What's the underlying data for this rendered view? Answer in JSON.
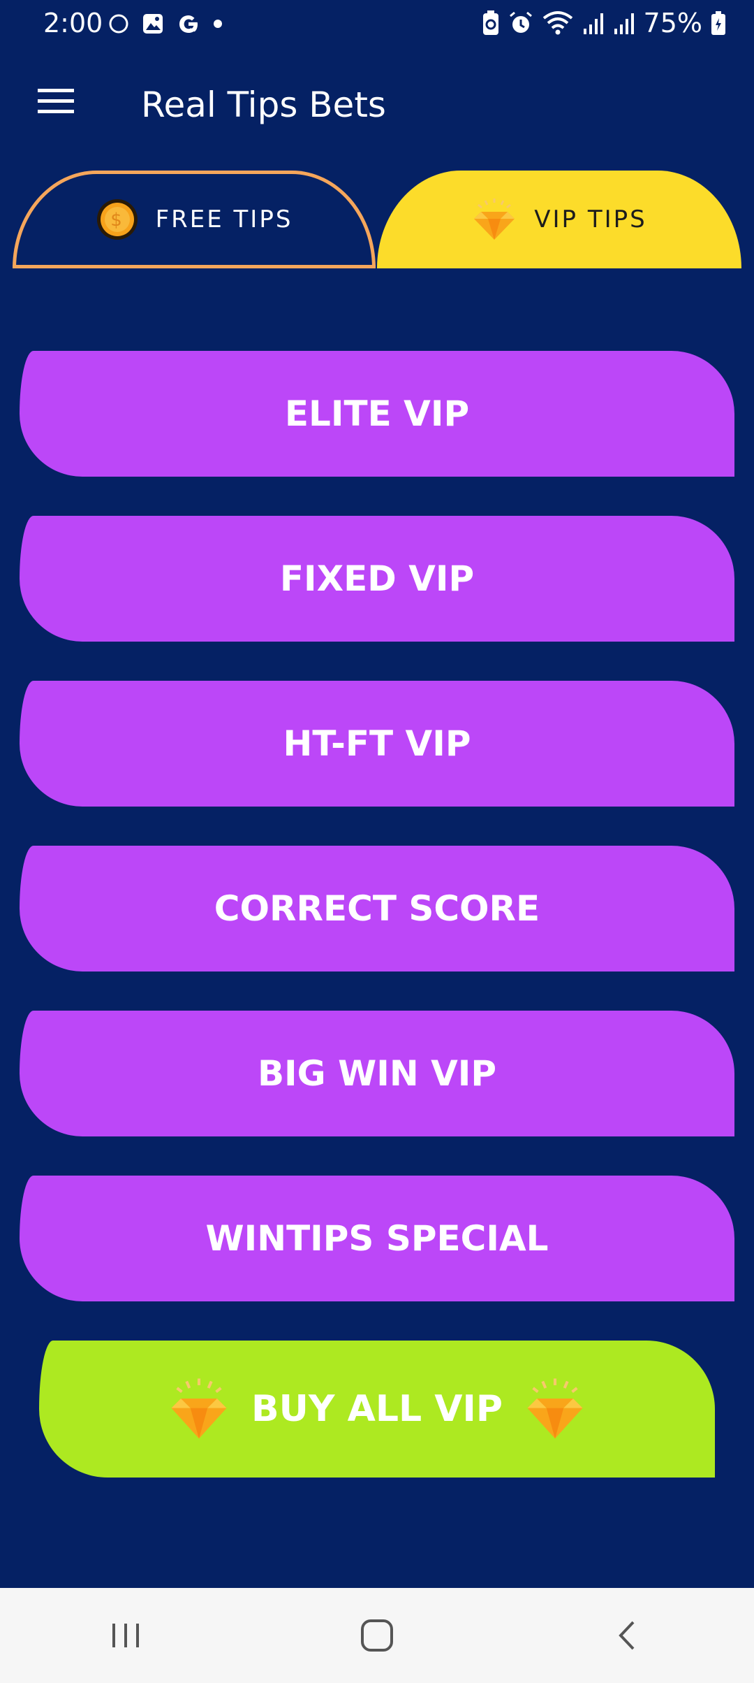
{
  "status_bar": {
    "time": "2:00",
    "battery": "75%",
    "left_icons": [
      "circle-icon",
      "image-icon",
      "google-icon",
      "dot-icon"
    ],
    "right_icons": [
      "battery-saver-icon",
      "alarm-icon",
      "wifi-icon",
      "signal-icon",
      "signal-icon",
      "battery-icon"
    ]
  },
  "app_bar": {
    "title": "Real Tips Bets",
    "menu_icon": "hamburger-menu-icon"
  },
  "tabs": [
    {
      "label": "FREE TIPS",
      "icon": "coin-icon",
      "active": false
    },
    {
      "label": "VIP TIPS",
      "icon": "diamond-icon",
      "active": true
    }
  ],
  "menu_items": [
    {
      "label": "ELITE VIP"
    },
    {
      "label": "FIXED VIP"
    },
    {
      "label": "HT-FT VIP"
    },
    {
      "label": "CORRECT SCORE"
    },
    {
      "label": "BIG WIN VIP"
    },
    {
      "label": "WINTIPS SPECIAL"
    }
  ],
  "buy_all": {
    "label": "BUY ALL VIP",
    "icon": "diamond-icon"
  },
  "colors": {
    "background": "#052164",
    "menu_item": "#bc47f8",
    "buy_all": "#ade921",
    "vip_tab": "#fcdc2a",
    "free_tab_border": "#f5a65b",
    "nav_bar": "#f6f6f6"
  },
  "nav_bar": {
    "icons": [
      "recent-apps-icon",
      "home-icon",
      "back-icon"
    ]
  }
}
